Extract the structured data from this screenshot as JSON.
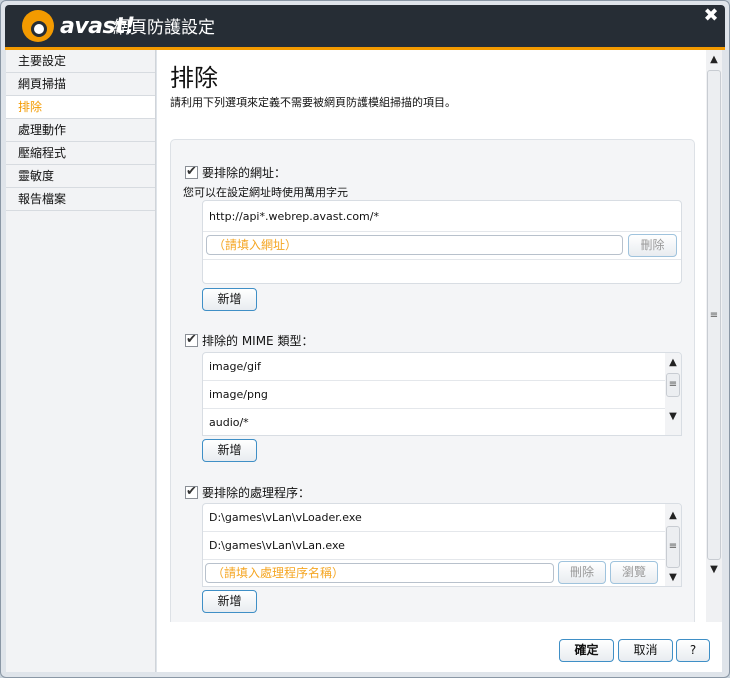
{
  "window": {
    "brand": "avast!",
    "title": "網頁防護設定",
    "close": "✖"
  },
  "sidebar": {
    "items": [
      {
        "label": "主要設定"
      },
      {
        "label": "網頁掃描"
      },
      {
        "label": "排除",
        "active": true
      },
      {
        "label": "處理動作"
      },
      {
        "label": "壓縮程式"
      },
      {
        "label": "靈敏度"
      },
      {
        "label": "報告檔案"
      }
    ]
  },
  "page": {
    "title": "排除",
    "description": "請利用下列選項來定義不需要被網頁防護模組掃描的項目。"
  },
  "urls": {
    "label": "要排除的網址：",
    "checked": true,
    "hint": "您可以在設定網址時使用萬用字元",
    "items": [
      "http://api*.webrep.avast.com/*"
    ],
    "placeholder": "（請填入網址）",
    "delete": "刪除",
    "add": "新增"
  },
  "mime": {
    "label": "排除的 MIME 類型：",
    "checked": true,
    "items": [
      "image/gif",
      "image/png",
      "audio/*"
    ],
    "add": "新增"
  },
  "processes": {
    "label": "要排除的處理程序：",
    "checked": true,
    "items": [
      "D:\\games\\vLan\\vLoader.exe",
      "D:\\games\\vLan\\vLan.exe"
    ],
    "placeholder": "（請填入處理程序名稱）",
    "delete": "刪除",
    "browse": "瀏覽",
    "add": "新增"
  },
  "footer": {
    "ok": "確定",
    "cancel": "取消",
    "help": "?"
  },
  "colors": {
    "accent": "#f39a00",
    "titlebar": "#262d35"
  }
}
